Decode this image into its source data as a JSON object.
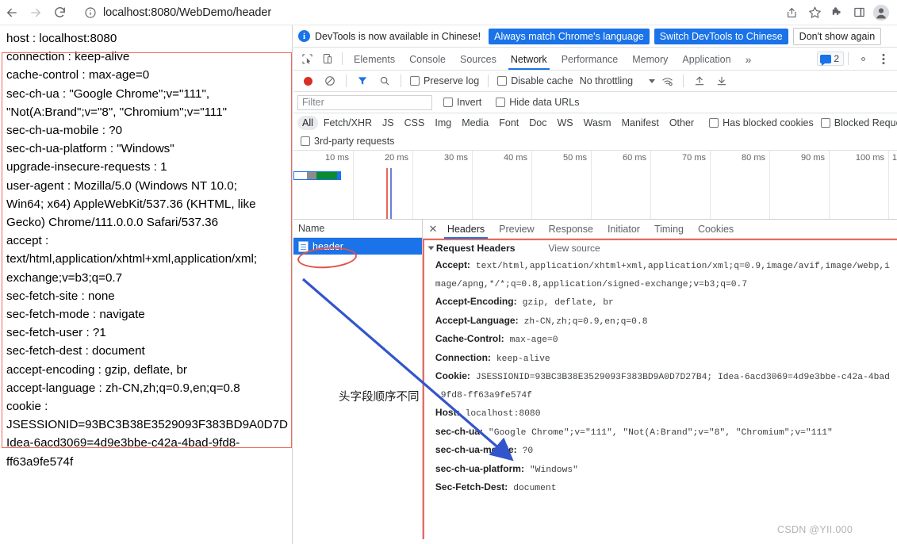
{
  "browser": {
    "back_label": "Back",
    "forward_label": "Forward",
    "reload_label": "Reload",
    "url_display": "localhost:8080/WebDemo/header",
    "url_host": "localhost:8080",
    "url_path": "/WebDemo/header",
    "icons": {
      "info": "info-icon",
      "share": "share-icon",
      "bookmark": "star-icon",
      "extensions": "puzzle-icon",
      "sidepanel": "side-panel-icon",
      "profile": "avatar-icon"
    }
  },
  "page": {
    "headers_text": "host : localhost:8080\nconnection : keep-alive\ncache-control : max-age=0\nsec-ch-ua : \"Google Chrome\";v=\"111\",\n\"Not(A:Brand\";v=\"8\", \"Chromium\";v=\"111\"\nsec-ch-ua-mobile : ?0\nsec-ch-ua-platform : \"Windows\"\nupgrade-insecure-requests : 1\nuser-agent : Mozilla/5.0 (Windows NT 10.0;\nWin64; x64) AppleWebKit/537.36 (KHTML, like\nGecko) Chrome/111.0.0.0 Safari/537.36\naccept :\ntext/html,application/xhtml+xml,application/xml;\nexchange;v=b3;q=0.7\nsec-fetch-site : none\nsec-fetch-mode : navigate\nsec-fetch-user : ?1\nsec-fetch-dest : document\naccept-encoding : gzip, deflate, br\naccept-language : zh-CN,zh;q=0.9,en;q=0.8\ncookie :\nJSESSIONID=93BC3B38E3529093F383BD9A0D7D\nIdea-6acd3069=4d9e3bbe-c42a-4bad-9fd8-\nff63a9fe574f"
  },
  "devtools": {
    "banner": {
      "message": "DevTools is now available in Chinese!",
      "btn_always_match": "Always match Chrome's language",
      "btn_switch": "Switch DevTools to Chinese",
      "btn_dismiss": "Don't show again"
    },
    "panel_tabs": [
      {
        "label": "Elements",
        "active": false
      },
      {
        "label": "Console",
        "active": false
      },
      {
        "label": "Sources",
        "active": false
      },
      {
        "label": "Network",
        "active": true
      },
      {
        "label": "Performance",
        "active": false
      },
      {
        "label": "Memory",
        "active": false
      },
      {
        "label": "Application",
        "active": false
      }
    ],
    "more_tabs_label": "»",
    "message_count": "2",
    "toolbar": {
      "record_label": "Record",
      "clear_label": "Clear",
      "filter_label": "Filter",
      "search_label": "Search",
      "preserve_log": "Preserve log",
      "disable_cache": "Disable cache",
      "throttling": "No throttling",
      "import_label": "Import HAR",
      "export_label": "Export HAR"
    },
    "filterbar": {
      "filter_placeholder": "Filter",
      "invert": "Invert",
      "hide_data_urls": "Hide data URLs"
    },
    "resource_types": [
      {
        "label": "All",
        "active": true
      },
      {
        "label": "Fetch/XHR",
        "active": false
      },
      {
        "label": "JS",
        "active": false
      },
      {
        "label": "CSS",
        "active": false
      },
      {
        "label": "Img",
        "active": false
      },
      {
        "label": "Media",
        "active": false
      },
      {
        "label": "Font",
        "active": false
      },
      {
        "label": "Doc",
        "active": false
      },
      {
        "label": "WS",
        "active": false
      },
      {
        "label": "Wasm",
        "active": false
      },
      {
        "label": "Manifest",
        "active": false
      },
      {
        "label": "Other",
        "active": false
      }
    ],
    "has_blocked_cookies": "Has blocked cookies",
    "blocked_requests": "Blocked Requests",
    "third_party_requests": "3rd-party requests",
    "overview": {
      "tick_labels": [
        "10 ms",
        "20 ms",
        "30 ms",
        "40 ms",
        "50 ms",
        "60 ms",
        "70 ms",
        "80 ms",
        "90 ms",
        "100 ms",
        "1"
      ],
      "event_markers": [
        "DOMContentLoaded",
        "Load"
      ]
    },
    "request_list": {
      "column_name": "Name",
      "rows": [
        {
          "name": "header",
          "type": "document",
          "selected": true
        }
      ]
    },
    "details": {
      "tabs": [
        {
          "label": "Headers",
          "active": true
        },
        {
          "label": "Preview",
          "active": false
        },
        {
          "label": "Response",
          "active": false
        },
        {
          "label": "Initiator",
          "active": false
        },
        {
          "label": "Timing",
          "active": false
        },
        {
          "label": "Cookies",
          "active": false
        }
      ],
      "section_title": "Request Headers",
      "view_source": "View source",
      "headers": [
        {
          "name": "Accept:",
          "value": "text/html,application/xhtml+xml,application/xml;q=0.9,image/avif,image/webp,image/apng,*/*;q=0.8,application/signed-exchange;v=b3;q=0.7"
        },
        {
          "name": "Accept-Encoding:",
          "value": "gzip, deflate, br"
        },
        {
          "name": "Accept-Language:",
          "value": "zh-CN,zh;q=0.9,en;q=0.8"
        },
        {
          "name": "Cache-Control:",
          "value": "max-age=0"
        },
        {
          "name": "Connection:",
          "value": "keep-alive"
        },
        {
          "name": "Cookie:",
          "value": "JSESSIONID=93BC3B38E3529093F383BD9A0D7D27B4; Idea-6acd3069=4d9e3bbe-c42a-4bad-9fd8-ff63a9fe574f"
        },
        {
          "name": "Host:",
          "value": "localhost:8080"
        },
        {
          "name": "sec-ch-ua:",
          "value": "\"Google Chrome\";v=\"111\", \"Not(A:Brand\";v=\"8\", \"Chromium\";v=\"111\""
        },
        {
          "name": "sec-ch-ua-mobile:",
          "value": "?0"
        },
        {
          "name": "sec-ch-ua-platform:",
          "value": "\"Windows\""
        },
        {
          "name": "Sec-Fetch-Dest:",
          "value": "document"
        }
      ]
    }
  },
  "annotations": {
    "chinese_note": "头字段顺序不同",
    "highlight_color": "#f2675c",
    "arrow_color": "#3355cc",
    "watermark": "CSDN @YII.000"
  }
}
